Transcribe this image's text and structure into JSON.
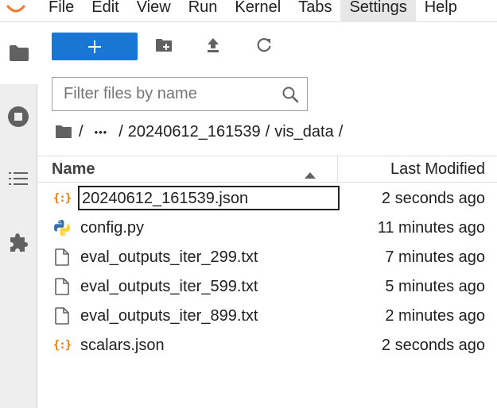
{
  "menu": {
    "items": [
      "File",
      "Edit",
      "View",
      "Run",
      "Kernel",
      "Tabs",
      "Settings",
      "Help"
    ],
    "active": "Settings"
  },
  "sidebar": {
    "tabs": [
      {
        "icon": "folder-icon",
        "active": true
      },
      {
        "icon": "stop-circle-icon",
        "active": false
      },
      {
        "icon": "list-icon",
        "active": false
      },
      {
        "icon": "puzzle-icon",
        "active": false
      }
    ]
  },
  "toolbar": {
    "new_label": "+",
    "icons": [
      "new-folder-icon",
      "upload-icon",
      "refresh-icon"
    ]
  },
  "filter": {
    "placeholder": "Filter files by name",
    "value": ""
  },
  "breadcrumb": {
    "sep1": "/",
    "ellipsis": "•••",
    "sep2": "/",
    "dir1": "20240612_161539",
    "sep3": "/",
    "dir2": "vis_data",
    "sep4": "/"
  },
  "file_list": {
    "col_name": "Name",
    "col_modified": "Last Modified",
    "sort": "ascending",
    "files": [
      {
        "name": "20240612_161539.json",
        "modified": "2 seconds ago",
        "type": "json",
        "icon": "json-file-icon",
        "editing": true
      },
      {
        "name": "config.py",
        "modified": "11 minutes ago",
        "type": "python",
        "icon": "python-file-icon",
        "editing": false
      },
      {
        "name": "eval_outputs_iter_299.txt",
        "modified": "7 minutes ago",
        "type": "text",
        "icon": "text-file-icon",
        "editing": false
      },
      {
        "name": "eval_outputs_iter_599.txt",
        "modified": "5 minutes ago",
        "type": "text",
        "icon": "text-file-icon",
        "editing": false
      },
      {
        "name": "eval_outputs_iter_899.txt",
        "modified": "2 minutes ago",
        "type": "text",
        "icon": "text-file-icon",
        "editing": false
      },
      {
        "name": "scalars.json",
        "modified": "2 seconds ago",
        "type": "json",
        "icon": "json-file-icon",
        "editing": false
      }
    ]
  },
  "colors": {
    "accent": "#1976d2",
    "json_icon": "#f57c00",
    "python_blue": "#3572a5",
    "python_yellow": "#ffd43b"
  }
}
